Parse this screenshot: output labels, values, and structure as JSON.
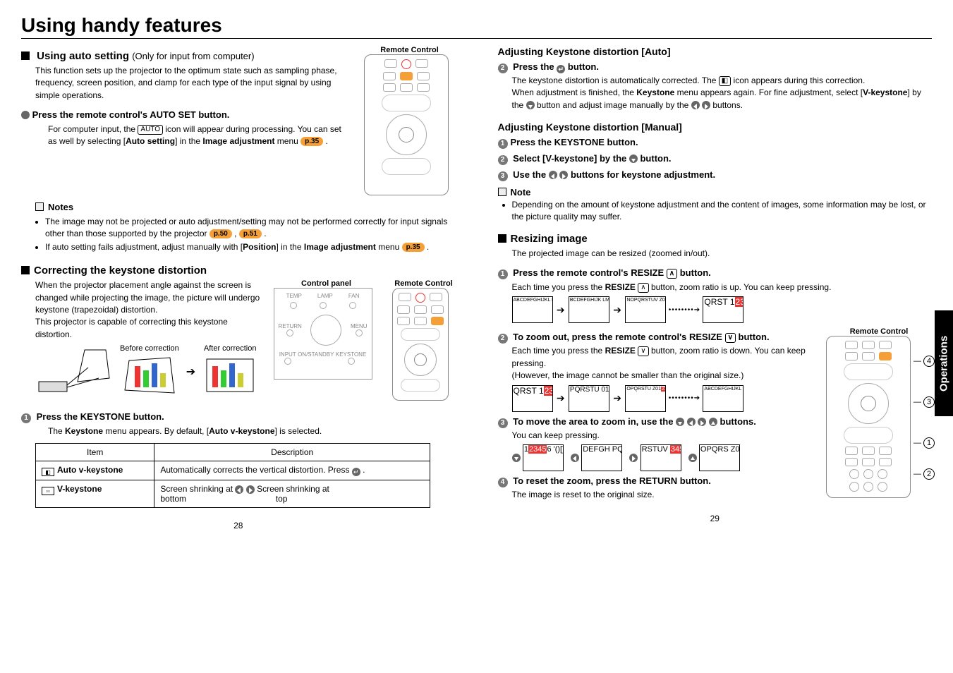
{
  "title": "Using handy features",
  "side_tab": "Operations",
  "pages": {
    "left": "28",
    "right": "29"
  },
  "left": {
    "auto_setting": {
      "heading": "Using auto setting",
      "heading_note": "(Only for input from computer)",
      "intro": "This function sets up the projector to the optimum state such as sampling phase, frequency, screen position, and clamp for each type of the input signal by using simple operations.",
      "step1_label": "Press the remote control's AUTO SET button.",
      "step1_body_a": "For computer input, the ",
      "step1_body_b": " icon will appear during processing. You can set as well by selecting [",
      "step1_bold1": "Auto setting",
      "step1_body_c": "] in the ",
      "step1_bold2": "Image adjustment",
      "step1_body_d": " menu ",
      "step1_pref": "p.35",
      "remote_label": "Remote Control",
      "notes_label": "Notes",
      "notes": [
        {
          "a": "The image may not be projected or auto adjustment/setting may not be performed correctly for input signals other than those supported by the projector ",
          "p1": "p.50",
          "sep": " , ",
          "p2": "p.51",
          "end": " ."
        },
        {
          "a": "If auto setting fails adjustment, adjust manually with [",
          "b": "Position",
          "c": "] in the ",
          "d": "Image adjustment",
          "e": " menu ",
          "p": "p.35",
          "end": " ."
        }
      ]
    },
    "keystone": {
      "heading": "Correcting the keystone distortion",
      "intro": "When the projector placement angle against the screen is changed while projecting the image, the picture will undergo keystone (trapezoidal) distortion.",
      "intro2": "This projector is capable of correcting this keystone distortion.",
      "before": "Before correction",
      "after": "After correction",
      "control_panel": "Control panel",
      "remote_label": "Remote Control",
      "step1": "Press the KEYSTONE button.",
      "step1_body_a": "The ",
      "step1_b1": "Keystone",
      "step1_body_b": " menu appears. By default, [",
      "step1_b2": "Auto v-keystone",
      "step1_body_c": "] is selected.",
      "table": {
        "h1": "Item",
        "h2": "Description",
        "r1_item": "Auto  v-keystone",
        "r1_desc_a": "Automatically corrects the vertical distortion. Press ",
        "r1_desc_b": " .",
        "r2_item": "V-keystone",
        "r2_desc_a": "Screen shrinking at ",
        "r2_desc_mid": "      Screen shrinking at",
        "r2_desc_b1": "bottom",
        "r2_desc_b2": "top"
      }
    }
  },
  "right": {
    "auto": {
      "heading": "Adjusting Keystone distortion [Auto]",
      "step2": "Press the ",
      "step2_end": " button.",
      "p1_a": "The keystone distortion is automatically corrected. The ",
      "p1_b": " icon appears during this correction.",
      "p2_a": "When adjustment is finished, the ",
      "p2_b": "Keystone",
      "p2_c": " menu appears again. For fine adjustment, select [",
      "p2_d": "V-keystone",
      "p2_e": "] by the ",
      "p2_f": " button and adjust image manually by the ",
      "p2_g": " buttons."
    },
    "manual": {
      "heading": "Adjusting Keystone distortion [Manual]",
      "s1": "Press the KEYSTONE button.",
      "s2_a": "Select [V-keystone] by the ",
      "s2_b": " button.",
      "s3_a": "Use the ",
      "s3_b": " buttons for keystone adjustment.",
      "note_h": "Note",
      "note": "Depending on the amount of keystone adjustment and the content of images, some information may be lost, or the picture quality may suffer."
    },
    "resize": {
      "heading": "Resizing image",
      "intro": "The projected image can be resized (zoomed in/out).",
      "s1_a": "Press the remote control's RESIZE ",
      "s1_b": " button.",
      "s1_body_a": "Each time you press the ",
      "s1_body_b": "RESIZE",
      "s1_body_c": " button, zoom ratio is up. You can keep pressing.",
      "s2_a": "To zoom out, press the remote control's RESIZE ",
      "s2_b": " button.",
      "s2_body_a": "Each time you press the ",
      "s2_body_b": "RESIZE",
      "s2_body_c": " button, zoom ratio is down. You can keep pressing.",
      "s2_body_d": "(However, the image cannot be smaller than the original size.)",
      "s3_a": "To move the area to zoom in, use the ",
      "s3_b": " buttons.",
      "s3_body": "You can keep pressing.",
      "s4": "To reset the zoom, press the RETURN button.",
      "s4_body": "The image is reset to the original size.",
      "remote_label": "Remote Control"
    }
  }
}
